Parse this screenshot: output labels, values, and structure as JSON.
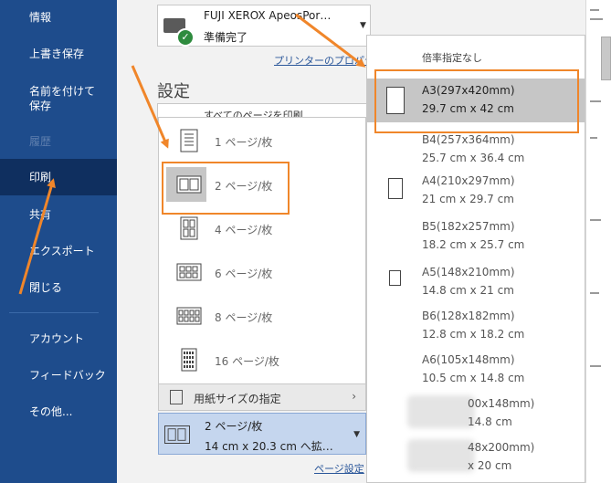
{
  "nav": {
    "items": [
      {
        "label": "情報",
        "state": "normal"
      },
      {
        "label": "上書き保存",
        "state": "normal"
      },
      {
        "label": "名前を付けて保存",
        "state": "normal"
      },
      {
        "label": "履歴",
        "state": "disabled"
      },
      {
        "label": "印刷",
        "state": "active"
      },
      {
        "label": "共有",
        "state": "normal"
      },
      {
        "label": "エクスポート",
        "state": "normal"
      },
      {
        "label": "閉じる",
        "state": "normal"
      },
      {
        "label": "アカウント",
        "state": "normal"
      },
      {
        "label": "フィードバック",
        "state": "normal"
      },
      {
        "label": "その他...",
        "state": "normal"
      }
    ]
  },
  "printer": {
    "name": "FUJI XEROX ApeosPor…",
    "status": "準備完了",
    "properties_link": "プリンターのプロパティ",
    "icon": "printer-icon",
    "status_icon": "check-icon"
  },
  "settings": {
    "heading": "設定",
    "print_scope": "すべてのページを印刷"
  },
  "pages_per_sheet": {
    "options": [
      {
        "label": "1 ページ/枚",
        "icon": "layout-1-icon"
      },
      {
        "label": "2 ページ/枚",
        "icon": "layout-2-icon",
        "selected": true
      },
      {
        "label": "4 ページ/枚",
        "icon": "layout-4-icon"
      },
      {
        "label": "6 ページ/枚",
        "icon": "layout-6-icon"
      },
      {
        "label": "8 ページ/枚",
        "icon": "layout-8-icon"
      },
      {
        "label": "16 ページ/枚",
        "icon": "layout-16-icon"
      }
    ],
    "paper_size_label": "用紙サイズの指定",
    "selected_title": "2 ページ/枚",
    "selected_sub": "14 cm x 20.3 cm へ拡…"
  },
  "page_setup_link": "ページ設定",
  "paper_sizes": {
    "header": "倍率指定なし",
    "items": [
      {
        "name": "A3(297x420mm)",
        "dims": "29.7 cm x 42 cm",
        "selected": true
      },
      {
        "name": "B4(257x364mm)",
        "dims": "25.7 cm x 36.4 cm"
      },
      {
        "name": "A4(210x297mm)",
        "dims": "21 cm x 29.7 cm"
      },
      {
        "name": "B5(182x257mm)",
        "dims": "18.2 cm x 25.7 cm"
      },
      {
        "name": "A5(148x210mm)",
        "dims": "14.8 cm x 21 cm"
      },
      {
        "name": "B6(128x182mm)",
        "dims": "12.8 cm x 18.2 cm"
      },
      {
        "name": "A6(105x148mm)",
        "dims": "10.5 cm x 14.8 cm"
      },
      {
        "name": "00x148mm)",
        "dims": "14.8 cm"
      },
      {
        "name": "48x200mm)",
        "dims": "x 20 cm"
      }
    ]
  },
  "colors": {
    "nav_bg": "#1e4c8c",
    "nav_active": "#0f2f5f",
    "highlight": "#f0862a",
    "arrow": "#f0862a",
    "selected_bg": "#c6c6c6",
    "link": "#2b579a"
  }
}
